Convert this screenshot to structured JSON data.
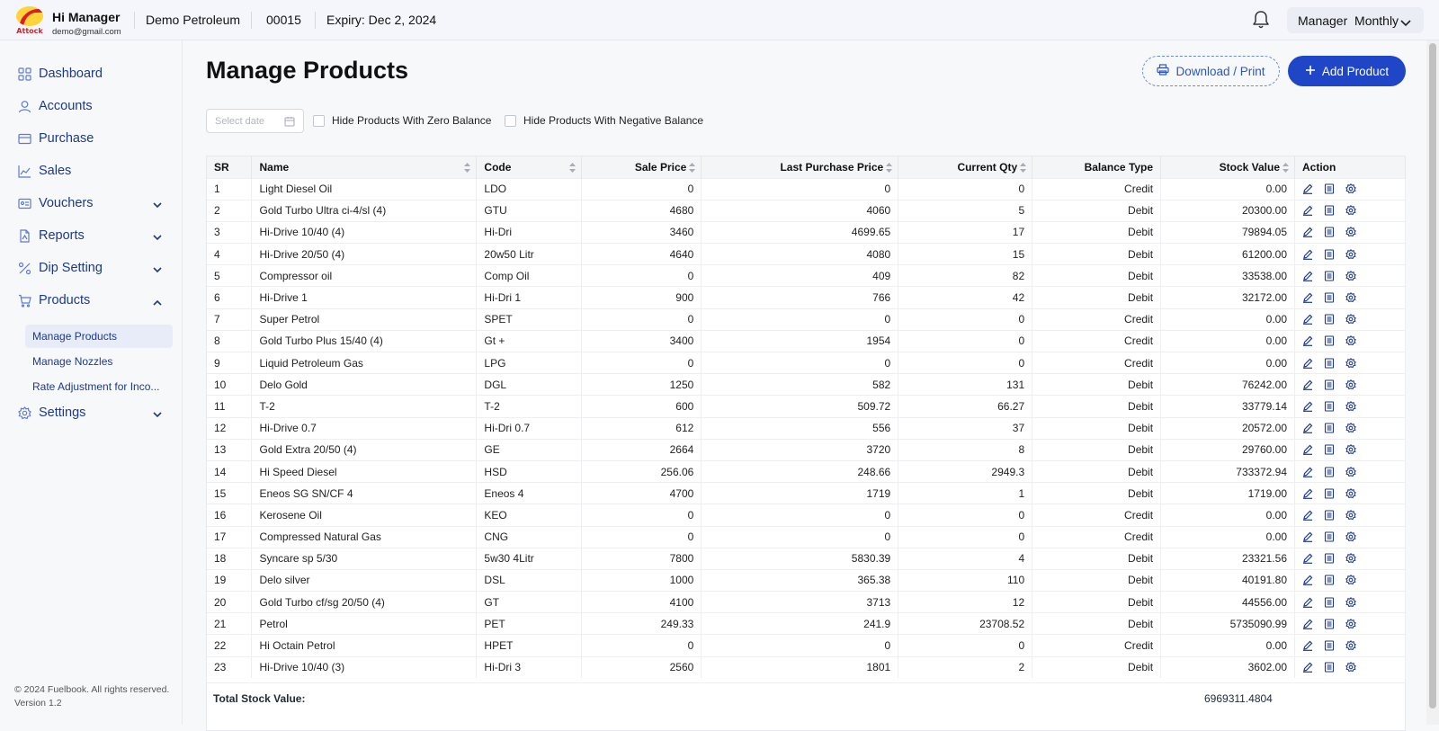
{
  "header": {
    "logo_text": "Attock",
    "brand": "Hi Manager",
    "email": "demo@gmail.com",
    "company": "Demo Petroleum",
    "code": "00015",
    "expiry": "Expiry: Dec 2, 2024",
    "role_label": "Manager  Monthly"
  },
  "sidebar": {
    "items": [
      {
        "label": "Dashboard",
        "icon": "grid-icon"
      },
      {
        "label": "Accounts",
        "icon": "user-icon"
      },
      {
        "label": "Purchase",
        "icon": "card-icon"
      },
      {
        "label": "Sales",
        "icon": "chart-line-icon"
      },
      {
        "label": "Vouchers",
        "icon": "id-card-icon"
      },
      {
        "label": "Reports",
        "icon": "file-pdf-icon"
      },
      {
        "label": "Dip Setting",
        "icon": "percent-icon"
      },
      {
        "label": "Products",
        "icon": "cart-icon"
      },
      {
        "label": "Settings",
        "icon": "gear-icon"
      }
    ],
    "sub_items": [
      {
        "label": "Manage Products"
      },
      {
        "label": "Manage Nozzles"
      },
      {
        "label": "Rate Adjustment for Inco..."
      }
    ],
    "footer_copyright": "© 2024 Fuelbook. All rights reserved.",
    "footer_version": "Version 1.2"
  },
  "main": {
    "title": "Manage Products",
    "download_label": "Download / Print",
    "add_label": "Add Product",
    "date_placeholder": "Select date",
    "hide_zero_label": "Hide Products With Zero Balance",
    "hide_negative_label": "Hide Products With Negative Balance"
  },
  "table": {
    "columns": [
      "SR",
      "Name",
      "Code",
      "Sale Price",
      "Last Purchase Price",
      "Current Qty",
      "Balance Type",
      "Stock Value",
      "Action"
    ],
    "rows": [
      [
        "1",
        "Light Diesel Oil",
        "LDO",
        "0",
        "0",
        "0",
        "Credit",
        "0.00"
      ],
      [
        "2",
        "Gold Turbo Ultra ci-4/sl (4)",
        "GTU",
        "4680",
        "4060",
        "5",
        "Debit",
        "20300.00"
      ],
      [
        "3",
        "Hi-Drive 10/40 (4)",
        "Hi-Dri",
        "3460",
        "4699.65",
        "17",
        "Debit",
        "79894.05"
      ],
      [
        "4",
        "Hi-Drive 20/50 (4)",
        "20w50 Litr",
        "4640",
        "4080",
        "15",
        "Debit",
        "61200.00"
      ],
      [
        "5",
        "Compressor oil",
        "Comp Oil",
        "0",
        "409",
        "82",
        "Debit",
        "33538.00"
      ],
      [
        "6",
        "Hi-Drive 1",
        "Hi-Dri 1",
        "900",
        "766",
        "42",
        "Debit",
        "32172.00"
      ],
      [
        "7",
        "Super Petrol",
        "SPET",
        "0",
        "0",
        "0",
        "Credit",
        "0.00"
      ],
      [
        "8",
        "Gold Turbo Plus 15/40 (4)",
        "Gt +",
        "3400",
        "1954",
        "0",
        "Credit",
        "0.00"
      ],
      [
        "9",
        "Liquid Petroleum Gas",
        "LPG",
        "0",
        "0",
        "0",
        "Credit",
        "0.00"
      ],
      [
        "10",
        "Delo Gold",
        "DGL",
        "1250",
        "582",
        "131",
        "Debit",
        "76242.00"
      ],
      [
        "11",
        "T-2",
        "T-2",
        "600",
        "509.72",
        "66.27",
        "Debit",
        "33779.14"
      ],
      [
        "12",
        "Hi-Drive 0.7",
        "Hi-Dri 0.7",
        "612",
        "556",
        "37",
        "Debit",
        "20572.00"
      ],
      [
        "13",
        "Gold Extra 20/50 (4)",
        "GE",
        "2664",
        "3720",
        "8",
        "Debit",
        "29760.00"
      ],
      [
        "14",
        "Hi Speed Diesel",
        "HSD",
        "256.06",
        "248.66",
        "2949.3",
        "Debit",
        "733372.94"
      ],
      [
        "15",
        "Eneos SG SN/CF 4",
        "Eneos 4",
        "4700",
        "1719",
        "1",
        "Debit",
        "1719.00"
      ],
      [
        "16",
        "Kerosene Oil",
        "KEO",
        "0",
        "0",
        "0",
        "Credit",
        "0.00"
      ],
      [
        "17",
        "Compressed Natural Gas",
        "CNG",
        "0",
        "0",
        "0",
        "Credit",
        "0.00"
      ],
      [
        "18",
        "Syncare sp 5/30",
        "5w30 4Litr",
        "7800",
        "5830.39",
        "4",
        "Debit",
        "23321.56"
      ],
      [
        "19",
        "Delo silver",
        "DSL",
        "1000",
        "365.38",
        "110",
        "Debit",
        "40191.80"
      ],
      [
        "20",
        "Gold Turbo cf/sg 20/50 (4)",
        "GT",
        "4100",
        "3713",
        "12",
        "Debit",
        "44556.00"
      ],
      [
        "21",
        "Petrol",
        "PET",
        "249.33",
        "241.9",
        "23708.52",
        "Debit",
        "5735090.99"
      ],
      [
        "22",
        "Hi Octain Petrol",
        "HPET",
        "0",
        "0",
        "0",
        "Credit",
        "0.00"
      ],
      [
        "23",
        "Hi-Drive 10/40 (3)",
        "Hi-Dri 3",
        "2560",
        "1801",
        "2",
        "Debit",
        "3602.00"
      ]
    ],
    "total_label": "Total Stock Value:",
    "total_value": "6969311.4804"
  },
  "colors": {
    "accent": "#1f46c7",
    "nav_text": "#1d3a8a",
    "action_icon": "#1d3a8a"
  }
}
